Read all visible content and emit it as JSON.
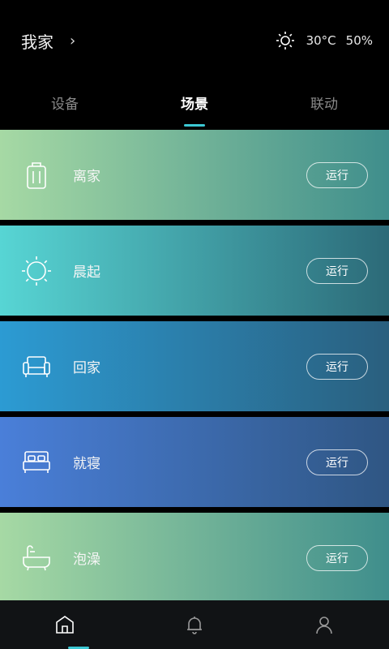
{
  "header": {
    "home_name": "我家",
    "chevron": "›",
    "weather_icon": "sun-icon",
    "temperature": "30°C",
    "humidity": "50%"
  },
  "tabs": [
    {
      "label": "设备",
      "active": false
    },
    {
      "label": "场景",
      "active": true
    },
    {
      "label": "联动",
      "active": false
    }
  ],
  "scenes": [
    {
      "label": "离家",
      "icon": "luggage-icon",
      "button": "运行",
      "gradient": [
        "#a6d9a4",
        "#3f8e8c"
      ]
    },
    {
      "label": "晨起",
      "icon": "sun-icon",
      "button": "运行",
      "gradient": [
        "#57d5d4",
        "#2c6a78"
      ]
    },
    {
      "label": "回家",
      "icon": "sofa-icon",
      "button": "运行",
      "gradient": [
        "#2c9bd3",
        "#2a5f7e"
      ]
    },
    {
      "label": "就寝",
      "icon": "bed-icon",
      "button": "运行",
      "gradient": [
        "#4a7fd9",
        "#2f5683"
      ]
    },
    {
      "label": "泡澡",
      "icon": "bathtub-icon",
      "button": "运行",
      "gradient": [
        "#a6d9a4",
        "#3f8e8c"
      ]
    }
  ],
  "bottom_nav": [
    {
      "icon": "home-icon",
      "active": true
    },
    {
      "icon": "bell-icon",
      "active": false
    },
    {
      "icon": "user-icon",
      "active": false
    }
  ],
  "colors": {
    "accent": "#3cc8d4",
    "background": "#000000",
    "nav_background": "#111315"
  }
}
